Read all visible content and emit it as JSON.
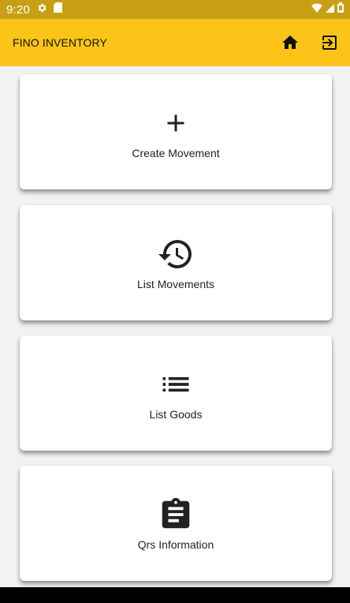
{
  "status_bar": {
    "time": "9:20",
    "icons": [
      "gear-icon",
      "sd-card-icon",
      "wifi-icon",
      "signal-icon",
      "battery-icon"
    ]
  },
  "app_bar": {
    "title": "FINO INVENTORY",
    "actions": [
      "home-icon",
      "logout-icon"
    ]
  },
  "cards": [
    {
      "label": "Create Movement",
      "icon": "add-icon"
    },
    {
      "label": "List Movements",
      "icon": "history-icon"
    },
    {
      "label": "List Goods",
      "icon": "list-icon"
    },
    {
      "label": "Qrs Information",
      "icon": "clipboard-icon"
    }
  ],
  "colors": {
    "app_bar": "#fcc419",
    "status_bar": "#c79f14",
    "background": "#f2f2f2",
    "card": "#ffffff"
  }
}
